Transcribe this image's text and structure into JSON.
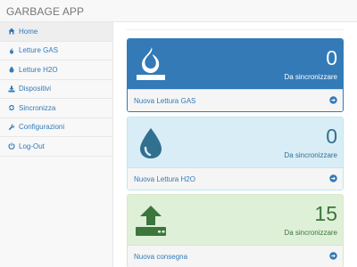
{
  "app": {
    "title": "GARBAGE APP"
  },
  "sidebar": {
    "items": [
      {
        "label": "Home",
        "icon": "home-icon",
        "active": true
      },
      {
        "label": "Letture GAS",
        "icon": "fire-icon"
      },
      {
        "label": "Letture H2O",
        "icon": "water-drop-icon"
      },
      {
        "label": "Dispositivi",
        "icon": "download-tray-icon"
      },
      {
        "label": "Sincronizza",
        "icon": "sync-icon"
      },
      {
        "label": "Configurazioni",
        "icon": "wrench-icon"
      },
      {
        "label": "Log-Out",
        "icon": "power-icon"
      }
    ]
  },
  "panels": {
    "gas": {
      "count": "0",
      "subtitle": "Da sincronizzare",
      "link": "Nuova Lettura GAS",
      "icon": "fire-icon",
      "color": "#337ab7"
    },
    "h2o": {
      "count": "0",
      "subtitle": "Da sincronizzare",
      "link": "Nuova Lettura H2O",
      "icon": "water-drop-icon",
      "color": "#d9edf7"
    },
    "delivery": {
      "count": "15",
      "subtitle": "Da sincronizzare",
      "link": "Nuova consegna",
      "icon": "upload-tray-icon",
      "color": "#dff0d8"
    }
  },
  "colors": {
    "link": "#337ab7",
    "info_text": "#31708f",
    "success_text": "#3c763d"
  }
}
